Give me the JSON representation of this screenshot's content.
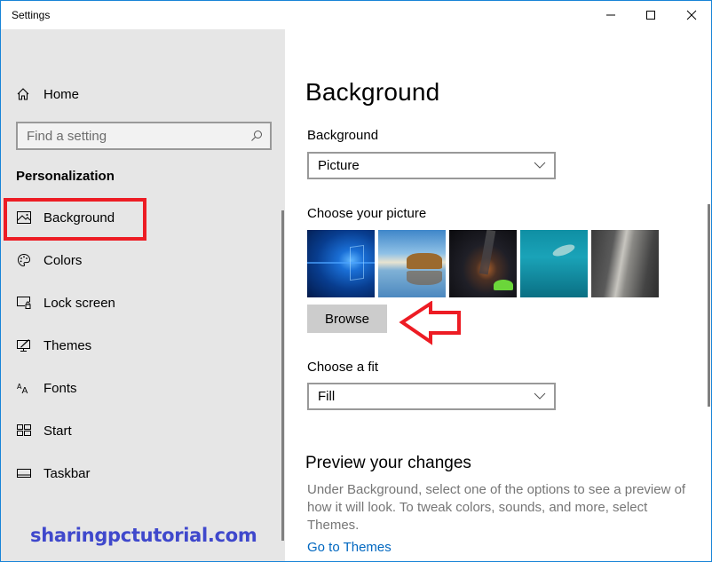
{
  "window": {
    "title": "Settings",
    "controls": {
      "minimize": "minimize",
      "maximize": "maximize",
      "close": "close"
    },
    "accent_color": "#1883d7"
  },
  "sidebar": {
    "home_label": "Home",
    "search_placeholder": "Find a setting",
    "search_value": "",
    "section_title": "Personalization",
    "items": [
      {
        "label": "Background",
        "icon": "picture-icon",
        "selected": true
      },
      {
        "label": "Colors",
        "icon": "palette-icon",
        "selected": false
      },
      {
        "label": "Lock screen",
        "icon": "lock-screen-icon",
        "selected": false
      },
      {
        "label": "Themes",
        "icon": "themes-icon",
        "selected": false
      },
      {
        "label": "Fonts",
        "icon": "fonts-icon",
        "selected": false
      },
      {
        "label": "Start",
        "icon": "start-icon",
        "selected": false
      },
      {
        "label": "Taskbar",
        "icon": "taskbar-icon",
        "selected": false
      }
    ]
  },
  "main": {
    "page_title": "Background",
    "background_label": "Background",
    "background_value": "Picture",
    "choose_picture_label": "Choose your picture",
    "pictures": [
      {
        "name": "windows-10-hero"
      },
      {
        "name": "beach-rock-arch"
      },
      {
        "name": "night-sky-tent"
      },
      {
        "name": "underwater-swimmer"
      },
      {
        "name": "rock-cliff"
      }
    ],
    "browse_label": "Browse",
    "choose_fit_label": "Choose a fit",
    "fit_value": "Fill",
    "preview_title": "Preview your changes",
    "preview_description": "Under Background, select one of the options to see a preview of how it will look. To tweak colors, sounds, and more, select Themes.",
    "goto_themes_link": "Go to Themes"
  },
  "annotations": {
    "watermark": "sharingpctutorial.com",
    "highlight_color": "#ed1c24",
    "watermark_color": "#3f48cc"
  }
}
